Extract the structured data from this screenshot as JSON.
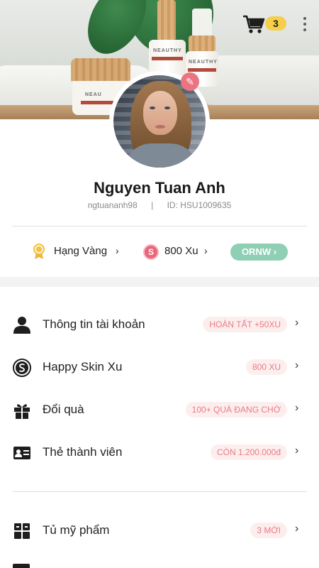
{
  "header": {
    "cart_count": "3",
    "product_brand_1": "NEAU",
    "product_brand_2": "NEAUTHY",
    "product_brand_3": "NEAUTHY"
  },
  "profile": {
    "name": "Nguyen Tuan Anh",
    "username": "ngtuananh98",
    "separator": "|",
    "user_id": "ID: HSU1009635"
  },
  "stats": {
    "rank_label": "Hạng Vàng",
    "rank_chevron": "›",
    "xu_icon_letter": "S",
    "xu_label": "800 Xu",
    "xu_chevron": "›",
    "code_label": "ORNW ›"
  },
  "menu": [
    {
      "label": "Thông tin tài khoản",
      "badge": "HOÀN TẤT +50XU",
      "icon": "person-icon"
    },
    {
      "label": "Happy Skin Xu",
      "badge": "800 XU",
      "icon": "coin-icon"
    },
    {
      "label": "Đổi quà",
      "badge": "100+ QUÀ ĐANG CHỜ",
      "icon": "gift-icon"
    },
    {
      "label": "Thẻ thành viên",
      "badge": "CÒN 1.200.000đ",
      "icon": "member-card-icon"
    },
    {
      "label": "Tủ mỹ phẩm",
      "badge": "3 MỚI",
      "icon": "cabinet-icon"
    }
  ],
  "chevron": "›",
  "colors": {
    "badge_bg": "#fdeeee",
    "badge_text": "#ea7a86",
    "accent_green": "#8fcfb4",
    "cart_badge": "#f5cf4a",
    "edit_badge": "#ec7480"
  }
}
